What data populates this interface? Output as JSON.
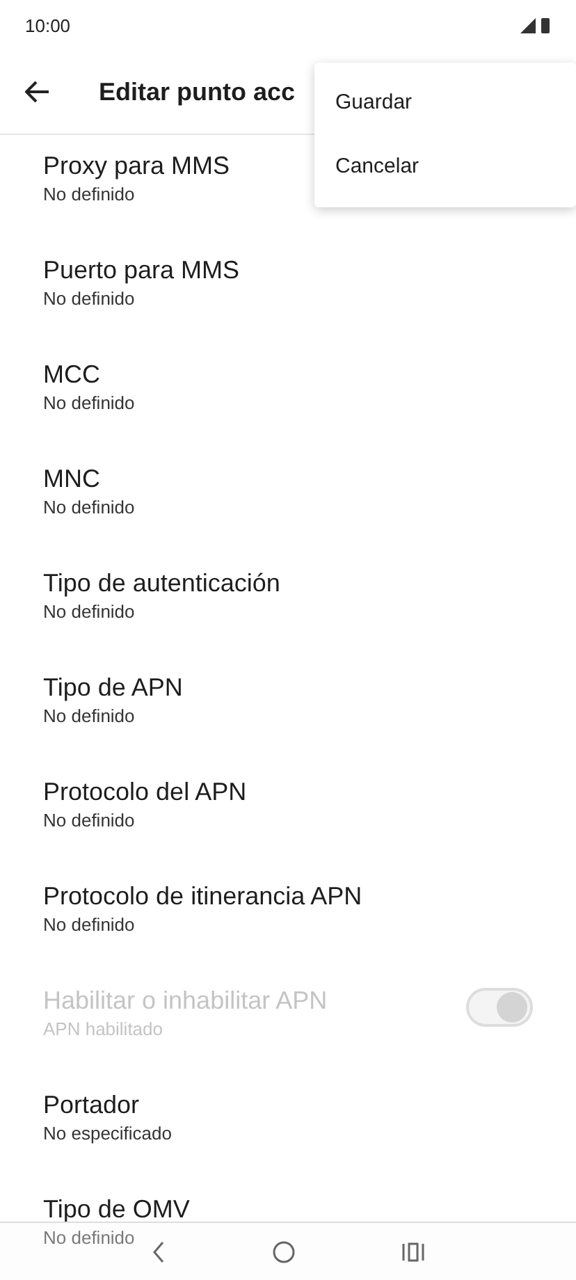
{
  "status_bar": {
    "time": "10:00"
  },
  "app_bar": {
    "title": "Editar punto acc"
  },
  "menu": {
    "items": [
      {
        "label": "Guardar"
      },
      {
        "label": "Cancelar"
      }
    ]
  },
  "settings": [
    {
      "kind": "text",
      "title": "Proxy para MMS",
      "subtitle": "No definido",
      "disabled": false
    },
    {
      "kind": "text",
      "title": "Puerto para MMS",
      "subtitle": "No definido",
      "disabled": false
    },
    {
      "kind": "text",
      "title": "MCC",
      "subtitle": "No definido",
      "disabled": false
    },
    {
      "kind": "text",
      "title": "MNC",
      "subtitle": "No definido",
      "disabled": false
    },
    {
      "kind": "text",
      "title": "Tipo de autenticación",
      "subtitle": "No definido",
      "disabled": false
    },
    {
      "kind": "text",
      "title": "Tipo de APN",
      "subtitle": "No definido",
      "disabled": false
    },
    {
      "kind": "text",
      "title": "Protocolo del APN",
      "subtitle": "No definido",
      "disabled": false
    },
    {
      "kind": "text",
      "title": "Protocolo de itinerancia APN",
      "subtitle": "No definido",
      "disabled": false
    },
    {
      "kind": "toggle",
      "title": "Habilitar o inhabilitar APN",
      "subtitle": "APN habilitado",
      "disabled": true,
      "on": true
    },
    {
      "kind": "text",
      "title": "Portador",
      "subtitle": "No especificado",
      "disabled": false
    },
    {
      "kind": "text",
      "title": "Tipo de OMV",
      "subtitle": "No definido",
      "disabled": false
    }
  ]
}
